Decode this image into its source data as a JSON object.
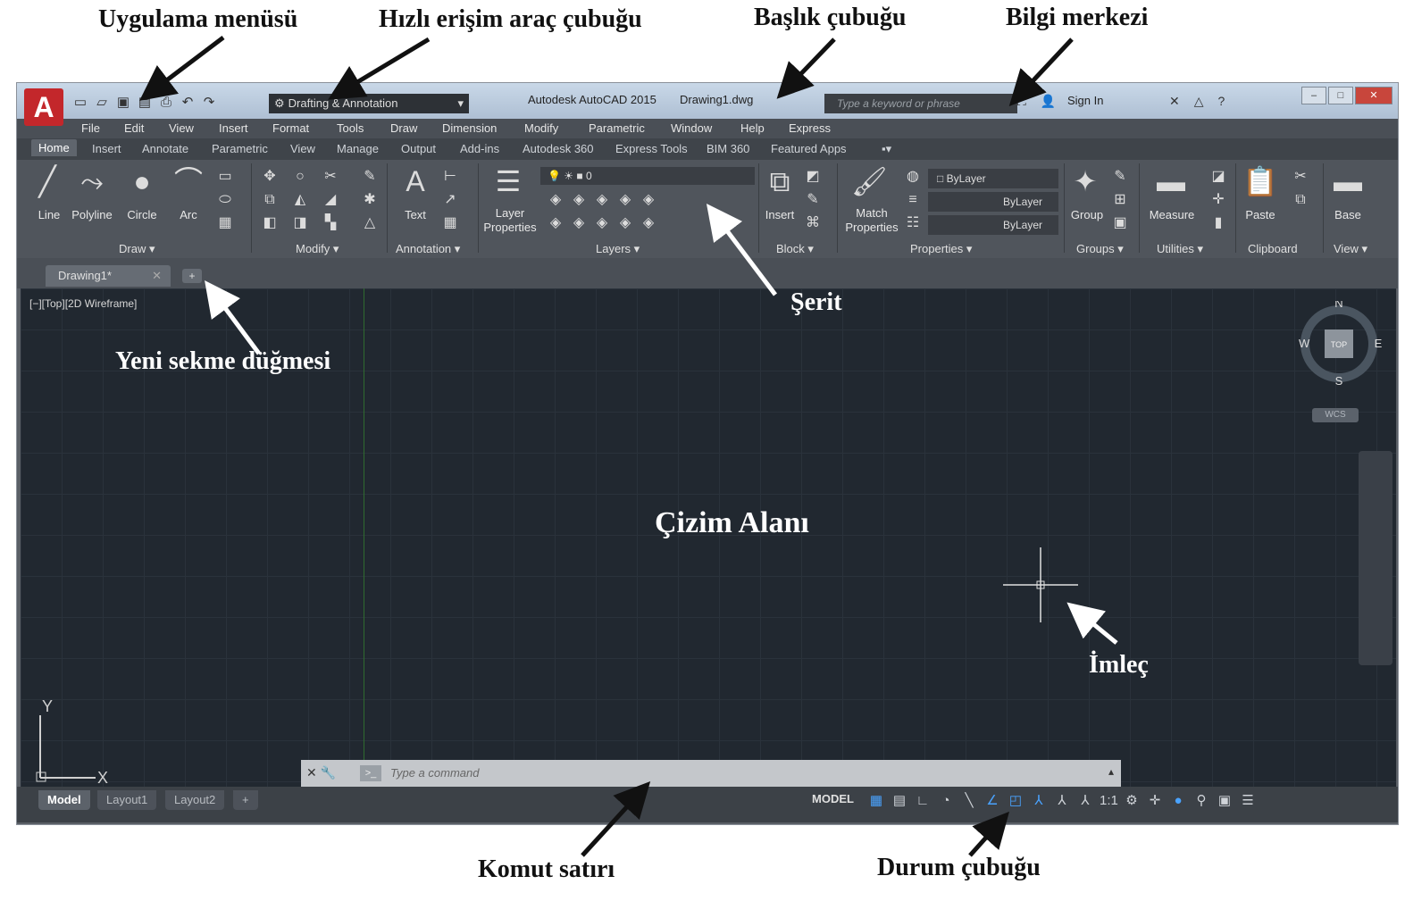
{
  "annotations": {
    "app_menu": "Uygulama menüsü",
    "quick_access": "Hızlı erişim araç çubuğu",
    "title_bar": "Başlık çubuğu",
    "info_center": "Bilgi merkezi",
    "ribbon": "Şerit",
    "new_tab_button": "Yeni sekme düğmesi",
    "drawing_area": "Çizim Alanı",
    "cursor": "İmleç",
    "command_line": "Komut satırı",
    "status_bar": "Durum çubuğu"
  },
  "window": {
    "app_button": "A",
    "workspace": "Drafting & Annotation",
    "title": "Autodesk AutoCAD 2015",
    "filename": "Drawing1.dwg",
    "search_placeholder": "Type a keyword or phrase",
    "sign_in": "Sign In"
  },
  "menubar": [
    "File",
    "Edit",
    "View",
    "Insert",
    "Format",
    "Tools",
    "Draw",
    "Dimension",
    "Modify",
    "Parametric",
    "Window",
    "Help",
    "Express"
  ],
  "ribbon_tabs": [
    "Home",
    "Insert",
    "Annotate",
    "Parametric",
    "View",
    "Manage",
    "Output",
    "Add-ins",
    "Autodesk 360",
    "Express Tools",
    "BIM 360",
    "Featured Apps"
  ],
  "ribbon": {
    "draw_tools": [
      "Line",
      "Polyline",
      "Circle",
      "Arc"
    ],
    "text_tool": "Text",
    "layer_properties": [
      "Layer",
      "Properties"
    ],
    "layer_current": "0",
    "insert_tool": "Insert",
    "match_properties": [
      "Match",
      "Properties"
    ],
    "bylayer": [
      "ByLayer",
      "ByLayer",
      "ByLayer"
    ],
    "group_tool": "Group",
    "measure_tool": "Measure",
    "paste_tool": "Paste",
    "base_tool": "Base",
    "panels": [
      "Draw ▾",
      "Modify ▾",
      "Annotation ▾",
      "Layers ▾",
      "Block ▾",
      "Properties ▾",
      "Groups ▾",
      "Utilities ▾",
      "Clipboard",
      "View ▾"
    ]
  },
  "document_tab": "Drawing1*",
  "viewport_label": "[−][Top][2D Wireframe]",
  "viewcube": {
    "n": "N",
    "s": "S",
    "e": "E",
    "w": "W",
    "top": "TOP",
    "wcs": "WCS"
  },
  "ucs": {
    "x": "X",
    "y": "Y"
  },
  "command": {
    "placeholder": "Type a command"
  },
  "layout_tabs": [
    "Model",
    "Layout1",
    "Layout2"
  ],
  "status": {
    "model": "MODEL",
    "scale": "1:1"
  }
}
